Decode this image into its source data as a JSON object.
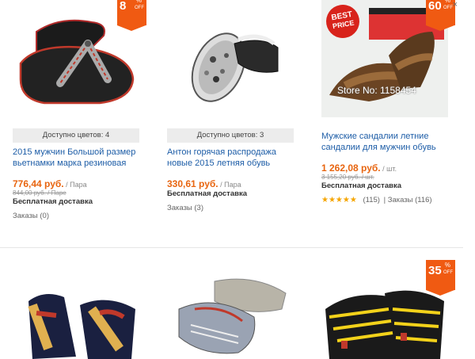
{
  "products": [
    {
      "badge": {
        "num": "8",
        "pct": "%",
        "off": "OFF"
      },
      "colors": "Доступно цветов: 4",
      "title": "2015 мужчин Большой размер вьетнамки марка резиновая",
      "price": "776,44 руб.",
      "unit": " / Пара",
      "old_price": "844,00 руб. / Паре",
      "shipping": "Бесплатная доставка",
      "orders": "Заказы (0)"
    },
    {
      "colors": "Доступно цветов: 3",
      "title": "Антон горячая распродажа новые 2015 летняя обувь",
      "price": "330,61 руб.",
      "unit": " / Пара",
      "shipping": "Бесплатная доставка",
      "orders": "Заказы (3)"
    },
    {
      "badge": {
        "num": "60",
        "pct": "%",
        "off": "OFF"
      },
      "title": "Мужские сандалии летние сандалии для мужчин обувь",
      "price": "1 262,08 руб.",
      "unit": " / шт.",
      "old_price": "3 155,20 руб. / шт.",
      "shipping": "Бесплатная доставка",
      "rating_stars": "★★★★★",
      "rating_count": "(115)",
      "orders": "| Заказы (116)",
      "overlay_text": "Store No: 1158454",
      "best_price_line1": "BEST",
      "best_price_line2": "PRICE"
    },
    {},
    {},
    {
      "badge": {
        "num": "35",
        "pct": "%",
        "off": "OFF"
      }
    }
  ],
  "close_glyph": "×",
  "colors": {
    "accent": "#f05a12",
    "link": "#1d5da7",
    "price": "#e86510"
  }
}
